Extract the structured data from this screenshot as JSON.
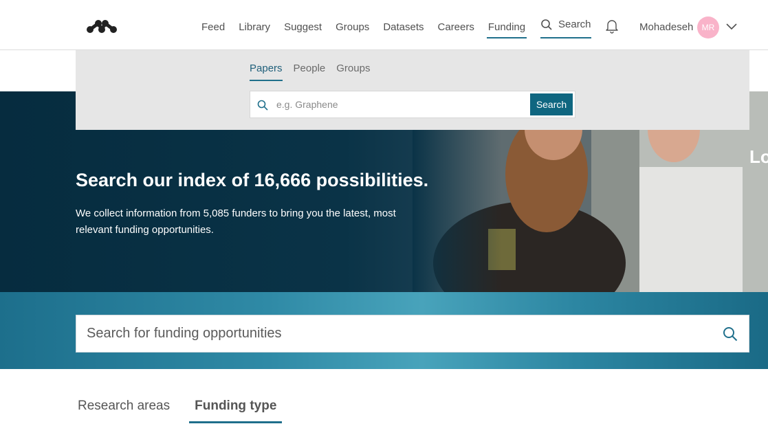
{
  "header": {
    "nav": [
      "Feed",
      "Library",
      "Suggest",
      "Groups",
      "Datasets",
      "Careers",
      "Funding"
    ],
    "active_nav": "Funding",
    "search_label": "Search",
    "user_name": "Mohadeseh",
    "avatar_initials": "MR",
    "avatar_color": "#f9b3c9"
  },
  "search_panel": {
    "tabs": [
      "Papers",
      "People",
      "Groups"
    ],
    "active_tab": "Papers",
    "placeholder": "e.g. Graphene",
    "button_label": "Search"
  },
  "hero": {
    "title": "Search our index of 16,666 possibilities.",
    "subtitle": "We collect information from 5,085 funders to bring you the latest, most relevant funding opportunities.",
    "edge_text": "Lo"
  },
  "funding_search": {
    "placeholder": "Search for funding opportunities"
  },
  "bottom_tabs": [
    "Research areas",
    "Funding type"
  ],
  "active_bottom_tab": "Funding type",
  "colors": {
    "accent": "#1f6f8b",
    "button": "#0f6680",
    "hero_dark": "#062c3f"
  }
}
